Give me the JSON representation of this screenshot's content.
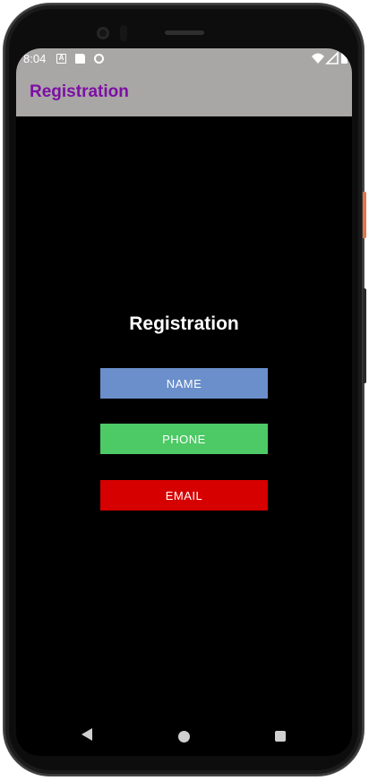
{
  "status_bar": {
    "time": "8:04"
  },
  "app_bar": {
    "title": "Registration"
  },
  "main": {
    "heading": "Registration",
    "buttons": {
      "name_label": "NAME",
      "phone_label": "PHONE",
      "email_label": "EMAIL"
    }
  },
  "colors": {
    "status_bar_bg": "#a9a6a6",
    "app_title": "#7d0ea4",
    "screen_bg": "#000000",
    "name_button": "#6a8fcb",
    "phone_button": "#4dc966",
    "email_button": "#d60000"
  },
  "icons": {
    "status_left": [
      "a-notification-icon",
      "sd-card-icon",
      "sync-icon"
    ],
    "status_right": [
      "wifi-icon",
      "cell-signal-icon",
      "battery-icon"
    ],
    "nav": [
      "back-icon",
      "home-icon",
      "recent-apps-icon"
    ]
  }
}
